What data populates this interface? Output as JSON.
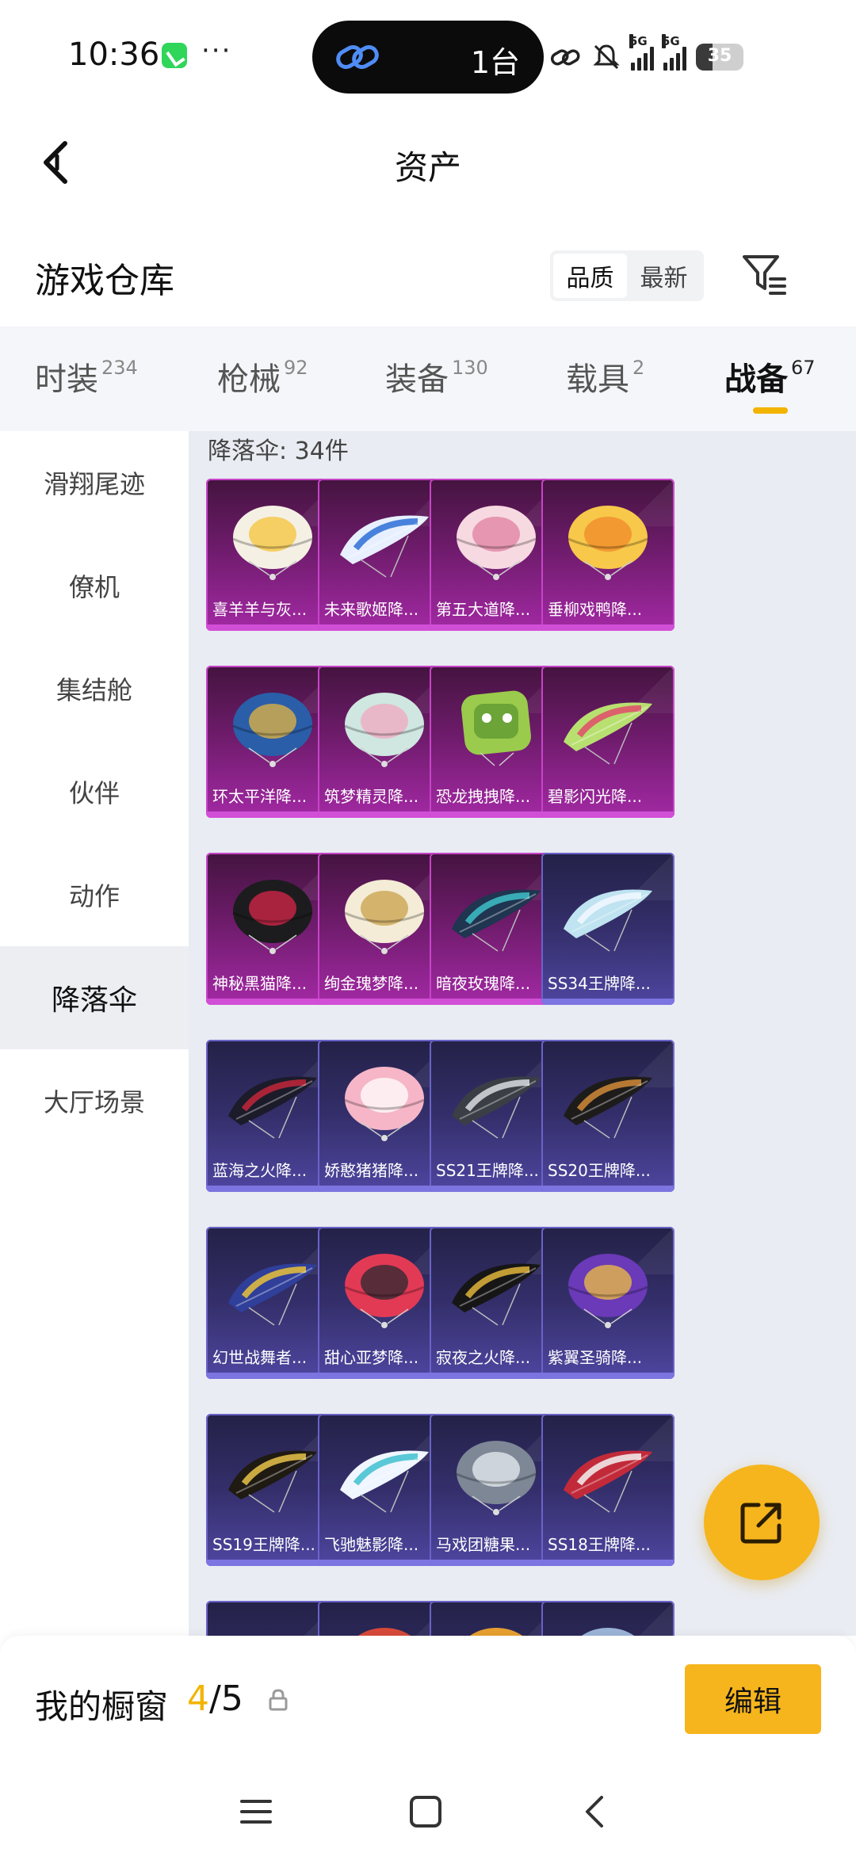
{
  "status_bar": {
    "time": "10:36",
    "dots": "···",
    "island_count": "1台",
    "network_1": "5G",
    "network_2": "5G",
    "battery": "35",
    "battery_level": 0.35
  },
  "header": {
    "title": "资产"
  },
  "warehouse": {
    "title": "游戏仓库",
    "sort_options": [
      "品质",
      "最新"
    ],
    "active_sort": 0
  },
  "tabs": [
    {
      "label": "时装",
      "count": "234"
    },
    {
      "label": "枪械",
      "count": "92"
    },
    {
      "label": "装备",
      "count": "130"
    },
    {
      "label": "载具",
      "count": "2"
    },
    {
      "label": "战备",
      "count": "67"
    }
  ],
  "active_tab": 4,
  "sidebar": {
    "items": [
      "滑翔尾迹",
      "僚机",
      "集结舱",
      "伙伴",
      "动作",
      "降落伞",
      "大厅场景"
    ],
    "active": 5
  },
  "section_title": "降落伞: 34件",
  "items": [
    {
      "name": "喜羊羊与灰...",
      "rarity": "purple",
      "art": "round",
      "c1": "#f5f0e4",
      "c2": "#f4c43a"
    },
    {
      "name": "未来歌姬降...",
      "rarity": "purple",
      "art": "glider",
      "c1": "#e8f0ff",
      "c2": "#2c6fd6"
    },
    {
      "name": "第五大道降...",
      "rarity": "purple",
      "art": "round",
      "c1": "#f7d9e1",
      "c2": "#e07fa0"
    },
    {
      "name": "垂柳戏鸭降...",
      "rarity": "purple",
      "art": "round",
      "c1": "#f7c84a",
      "c2": "#f08a2a"
    },
    {
      "name": "环太平洋降...",
      "rarity": "purple",
      "art": "round",
      "c1": "#2a5ea8",
      "c2": "#e6b642"
    },
    {
      "name": "筑梦精灵降...",
      "rarity": "purple",
      "art": "round",
      "c1": "#cfe7e0",
      "c2": "#f0a8c2"
    },
    {
      "name": "恐龙拽拽降...",
      "rarity": "purple",
      "art": "square",
      "c1": "#9acb4c",
      "c2": "#4f8a2a"
    },
    {
      "name": "碧影闪光降...",
      "rarity": "purple",
      "art": "glider",
      "c1": "#b8e070",
      "c2": "#e04a6a"
    },
    {
      "name": "神秘黑猫降...",
      "rarity": "purple",
      "art": "round",
      "c1": "#1c1c1e",
      "c2": "#d8254a"
    },
    {
      "name": "绚金瑰梦降...",
      "rarity": "purple",
      "art": "round",
      "c1": "#f4ecd6",
      "c2": "#c9a24a"
    },
    {
      "name": "暗夜玫瑰降...",
      "rarity": "purple",
      "art": "glider",
      "c1": "#1f3550",
      "c2": "#3ec0c8"
    },
    {
      "name": "SS34王牌降...",
      "rarity": "blue",
      "art": "glider",
      "c1": "#bfe3f0",
      "c2": "#f2f8ff"
    },
    {
      "name": "蓝海之火降...",
      "rarity": "blue",
      "art": "glider",
      "c1": "#1b1b2a",
      "c2": "#c2263a"
    },
    {
      "name": "娇憨猪猪降...",
      "rarity": "blue",
      "art": "round",
      "c1": "#f6b6c8",
      "c2": "#ffffff"
    },
    {
      "name": "SS21王牌降...",
      "rarity": "blue",
      "art": "glider",
      "c1": "#3a3f45",
      "c2": "#d9dde0"
    },
    {
      "name": "SS20王牌降...",
      "rarity": "blue",
      "art": "glider",
      "c1": "#1e1c1a",
      "c2": "#d08a3a"
    },
    {
      "name": "幻世战舞者...",
      "rarity": "blue",
      "art": "glider",
      "c1": "#2f3f9a",
      "c2": "#e9c23a"
    },
    {
      "name": "甜心亚梦降...",
      "rarity": "blue",
      "art": "round",
      "c1": "#e23a55",
      "c2": "#2a2a30"
    },
    {
      "name": "寂夜之火降...",
      "rarity": "blue",
      "art": "glider",
      "c1": "#161616",
      "c2": "#e0b43a"
    },
    {
      "name": "紫翼圣骑降...",
      "rarity": "blue",
      "art": "round",
      "c1": "#6a3ab8",
      "c2": "#f0c040"
    },
    {
      "name": "SS19王牌降...",
      "rarity": "blue",
      "art": "glider",
      "c1": "#1f1a12",
      "c2": "#e7c34a"
    },
    {
      "name": "飞驰魅影降...",
      "rarity": "blue",
      "art": "glider",
      "c1": "#f0f6ff",
      "c2": "#3ec0d0"
    },
    {
      "name": "马戏团糖果...",
      "rarity": "blue",
      "art": "round",
      "c1": "#7d8796",
      "c2": "#e9edf2"
    },
    {
      "name": "SS18王牌降...",
      "rarity": "blue",
      "art": "glider",
      "c1": "#c22a3a",
      "c2": "#f2f2f2"
    },
    {
      "name": "",
      "rarity": "blue",
      "art": "none",
      "c1": "#333",
      "c2": "#444"
    },
    {
      "name": "",
      "rarity": "blue",
      "art": "round",
      "c1": "#d84a3a",
      "c2": "#f0a040"
    },
    {
      "name": "",
      "rarity": "blue",
      "art": "round",
      "c1": "#e8a030",
      "c2": "#d04040"
    },
    {
      "name": "",
      "rarity": "blue",
      "art": "round",
      "c1": "#9ab4d8",
      "c2": "#f0f0f0"
    }
  ],
  "showcase": {
    "label": "我的橱窗",
    "current": "4",
    "max": "/5",
    "edit_label": "编辑"
  },
  "colors": {
    "accent": "#f6b51c",
    "purple_rarity": "#a329a4",
    "blue_rarity": "#4e46a0"
  },
  "icons": {
    "back": "back-arrow-icon",
    "filter": "filter-icon",
    "share": "share-external-icon",
    "lock": "lock-icon",
    "nav_menu": "menu-icon",
    "nav_home": "home-square-icon",
    "nav_back": "back-chevron-icon"
  }
}
